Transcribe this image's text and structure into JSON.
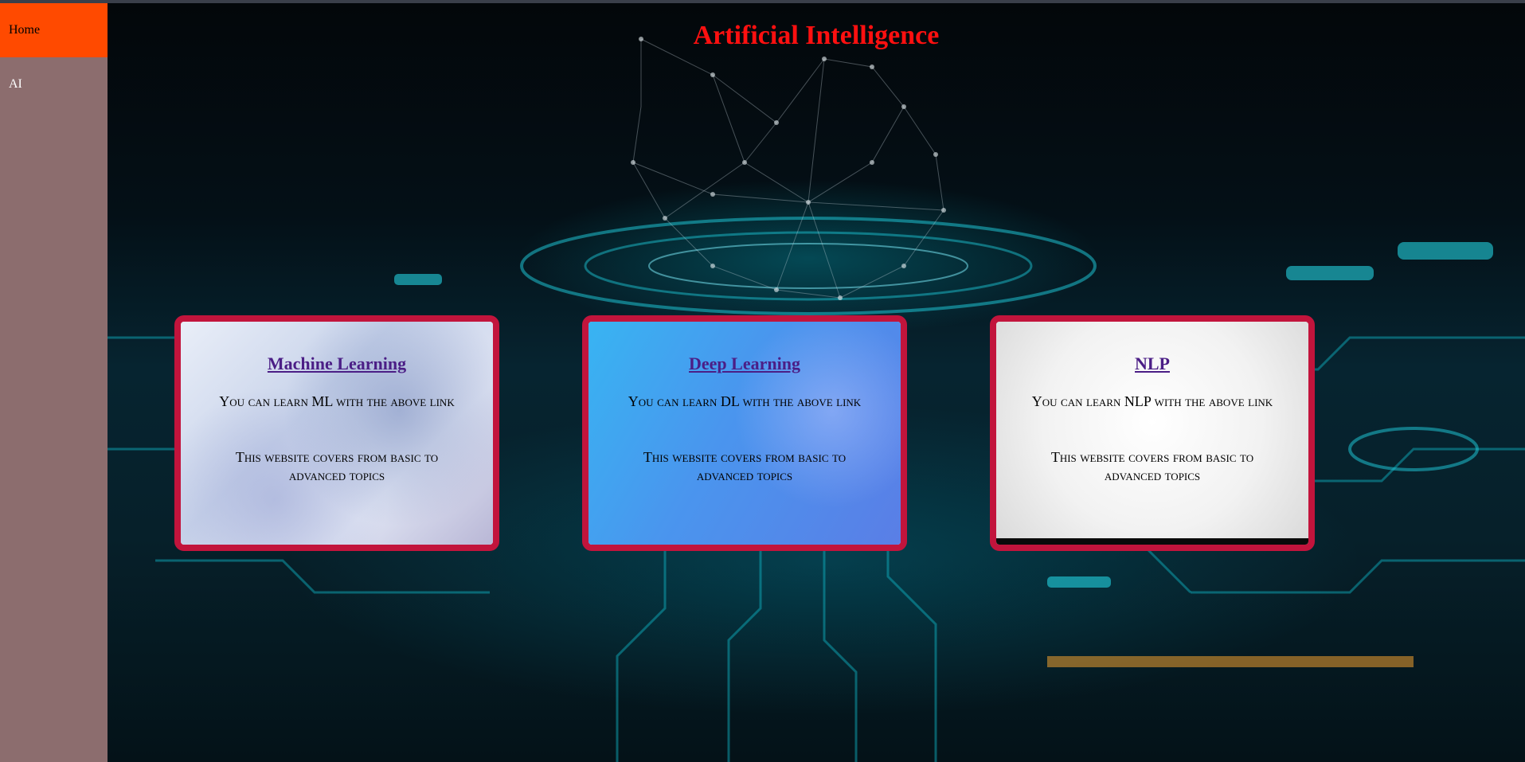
{
  "sidebar": {
    "items": [
      {
        "label": "Home",
        "active": true
      },
      {
        "label": "AI",
        "active": false
      }
    ],
    "background_color": "#8c6d6e",
    "active_color": "#ff4a00"
  },
  "header": {
    "title": "Artificial Intelligence",
    "title_color": "#ff1010"
  },
  "cards": [
    {
      "link_text": "Machine Learning",
      "line1": "You can learn ML with the above link",
      "line2": "This website covers from basic to advanced topics"
    },
    {
      "link_text": "Deep Learning",
      "line1": "You can learn DL with the above link",
      "line2": "This website covers from basic to advanced topics"
    },
    {
      "link_text": "NLP",
      "line1": "You can learn NLP with the above link",
      "line2": "This website covers from basic to advanced topics"
    }
  ],
  "colors": {
    "card_border": "#c2143c",
    "link": "#4b1e86"
  }
}
